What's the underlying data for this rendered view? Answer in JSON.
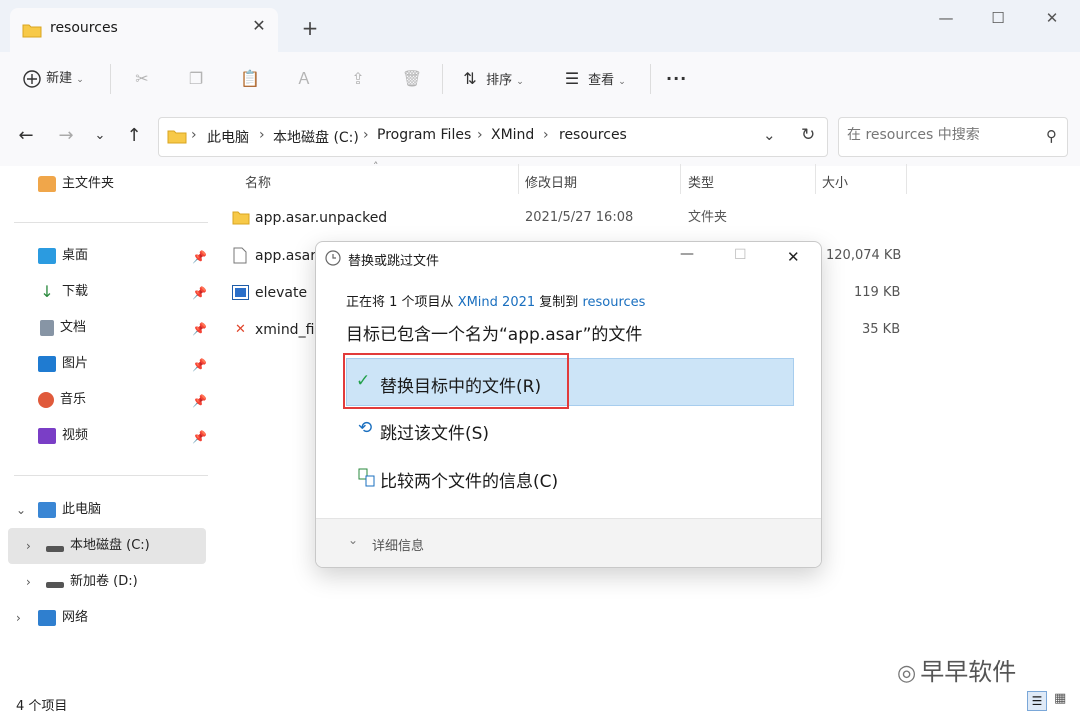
{
  "window": {
    "tab_title": "resources",
    "new_tab": "+",
    "minimize": "—",
    "maximize": "☐",
    "close": "✕"
  },
  "toolbar": {
    "new_label": "新建",
    "sort_label": "排序",
    "view_label": "查看",
    "more": "···"
  },
  "address": {
    "crumbs": [
      "此电脑",
      "本地磁盘 (C:)",
      "Program Files",
      "XMind",
      "resources"
    ],
    "search_placeholder": "在 resources 中搜索"
  },
  "sidebar": {
    "home": "主文件夹",
    "quick": [
      {
        "label": "桌面",
        "color": "#2b9be0"
      },
      {
        "label": "下载",
        "color": "#2b8a3e"
      },
      {
        "label": "文档",
        "color": "#6c7a8a"
      },
      {
        "label": "图片",
        "color": "#1f7bd1"
      },
      {
        "label": "音乐",
        "color": "#e05a3b"
      },
      {
        "label": "视频",
        "color": "#7a3ec6"
      }
    ],
    "this_pc": "此电脑",
    "drive_c": "本地磁盘 (C:)",
    "drive_d": "新加卷 (D:)",
    "network": "网络"
  },
  "columns": {
    "name": "名称",
    "date": "修改日期",
    "type": "类型",
    "size": "大小"
  },
  "files": [
    {
      "name": "app.asar.unpacked",
      "date": "2021/5/27 16:08",
      "type": "文件夹",
      "size": ""
    },
    {
      "name": "app.asar",
      "size": "120,074 KB"
    },
    {
      "name": "elevate",
      "size": "119 KB"
    },
    {
      "name": "xmind_fil",
      "size": "35 KB"
    }
  ],
  "dialog": {
    "title": "替换或跳过文件",
    "line1_pre": "正在将 1 个项目从",
    "line1_src": "XMind 2021",
    "line1_mid": "复制到",
    "line1_dst": "resources",
    "heading": "目标已包含一个名为“app.asar”的文件",
    "opt_replace": "替换目标中的文件(R)",
    "opt_skip": "跳过该文件(S)",
    "opt_compare": "比较两个文件的信息(C)",
    "details": "详细信息",
    "link_color": "#1a6fbf"
  },
  "status": {
    "count": "4 个项目"
  },
  "watermark": "早早软件"
}
